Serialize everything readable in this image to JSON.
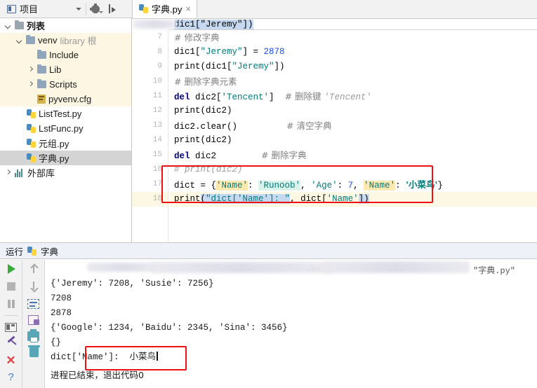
{
  "toolbar": {
    "project_label": "项目",
    "project_icon": "project-icon",
    "settings_icon": "gear-icon",
    "collapse_icon": "collapse-all-icon"
  },
  "editor_tab": {
    "label": "字典.py",
    "close_glyph": "×",
    "file_icon": "python-file-icon"
  },
  "tree": {
    "items": [
      {
        "label": "列表",
        "indent": 0,
        "arrow": "down",
        "icon": "folder-icon",
        "style": "root"
      },
      {
        "label": "venv",
        "indent": 1,
        "arrow": "down",
        "icon": "folder-icon",
        "style": "venv",
        "suffix": "library 根"
      },
      {
        "label": "Include",
        "indent": 2,
        "arrow": "none",
        "icon": "folder-icon",
        "style": "venv"
      },
      {
        "label": "Lib",
        "indent": 2,
        "arrow": "right",
        "icon": "folder-icon",
        "style": "venv"
      },
      {
        "label": "Scripts",
        "indent": 2,
        "arrow": "right",
        "icon": "folder-icon",
        "style": "venv"
      },
      {
        "label": "pyvenv.cfg",
        "indent": 2,
        "arrow": "none",
        "icon": "config-file-icon",
        "style": "venv"
      },
      {
        "label": "ListTest.py",
        "indent": 1,
        "arrow": "none",
        "icon": "python-file-icon",
        "style": "normal"
      },
      {
        "label": "LstFunc.py",
        "indent": 1,
        "arrow": "none",
        "icon": "python-file-icon",
        "style": "normal"
      },
      {
        "label": "元组.py",
        "indent": 1,
        "arrow": "none",
        "icon": "python-file-icon",
        "style": "normal"
      },
      {
        "label": "字典.py",
        "indent": 1,
        "arrow": "none",
        "icon": "python-file-icon",
        "style": "selected"
      },
      {
        "label": "外部库",
        "indent": 0,
        "arrow": "right",
        "icon": "external-libs-icon",
        "style": "normal"
      }
    ]
  },
  "code": {
    "cutoff_line": "dic1[\"Jeremy\"])",
    "line_numbers": [
      "7",
      "8",
      "9",
      "10",
      "11",
      "12",
      "13",
      "14",
      "15",
      "16",
      "17",
      "18"
    ],
    "lines": [
      {
        "no": "7",
        "text": "# 修改字典"
      },
      {
        "no": "8",
        "text": "dic1[\"Jeremy\"] = 2878"
      },
      {
        "no": "9",
        "text": "print(dic1[\"Jeremy\"])"
      },
      {
        "no": "10",
        "text": "# 删除字典元素"
      },
      {
        "no": "11",
        "text": "del dic2['Tencent']  # 删除键 'Tencent'"
      },
      {
        "no": "12",
        "text": "print(dic2)"
      },
      {
        "no": "13",
        "text": "dic2.clear()          # 清空字典"
      },
      {
        "no": "14",
        "text": "print(dic2)"
      },
      {
        "no": "15",
        "text": "del dic2        # 删除字典"
      },
      {
        "no": "16",
        "text": "# print(dic2)"
      },
      {
        "no": "17",
        "text": "dict = {'Name': 'Runoob', 'Age': 7, 'Name': '小菜鸟'}"
      },
      {
        "no": "18",
        "text": "print(\"dict['Name']: \", dict['Name'])"
      }
    ],
    "tokens": {
      "l7_comment": "# 修改字典",
      "l8_var": "dic1[",
      "l8_str": "\"Jeremy\"",
      "l8_assign": "] = ",
      "l8_num": "2878",
      "l9_fn": "print",
      "l9_body": "(dic1[",
      "l9_str": "\"Jeremy\"",
      "l9_tail": "])",
      "l10_comment": "# 删除字典元素",
      "l11_kw": "del",
      "l11_var": " dic2[",
      "l11_str": "'Tencent'",
      "l11_tail": "]  ",
      "l11_comment": "# 删除键 ",
      "l11_comment_i": "'Tencent'",
      "l12_fn": "print",
      "l12_tail": "(dic2)",
      "l13_var": "dic2.clear()",
      "l13_comment": "# 清空字典",
      "l14_fn": "print",
      "l14_tail": "(dic2)",
      "l15_kw": "del",
      "l15_var": " dic2",
      "l15_comment": "# 删除字典",
      "l16_comment": "# print(dic2)",
      "l17_a": "dict = {",
      "l17_key1": "'Name'",
      "l17_b": ": ",
      "l17_val1": "'Runoob'",
      "l17_c": ", ",
      "l17_key2": "'Age'",
      "l17_d": ": ",
      "l17_num": "7",
      "l17_e": ", ",
      "l17_key3": "'Name'",
      "l17_f": ": ",
      "l17_val3": "'小菜鸟'",
      "l17_g": "}",
      "l18_fn": "print",
      "l18_open": "(",
      "l18_str": "\"dict['Name']: \"",
      "l18_mid": ", dict[",
      "l18_str2": "'Name'",
      "l18_close": "])"
    }
  },
  "run_panel": {
    "tab_label": "运行",
    "config_name": "字典",
    "config_icon": "python-file-icon",
    "toolbar_left": [
      {
        "name": "run-button",
        "icon": "play-icon"
      },
      {
        "name": "stop-button",
        "icon": "stop-icon"
      },
      {
        "name": "pause-button",
        "icon": "pause-icon"
      },
      {
        "name": "layout-button",
        "icon": "layout-icon"
      },
      {
        "name": "pin-button",
        "icon": "pin-icon"
      },
      {
        "name": "close-button",
        "icon": "close-icon"
      },
      {
        "name": "help-button",
        "icon": "help-icon"
      }
    ],
    "toolbar_right": [
      {
        "name": "scroll-up-button",
        "icon": "arrow-up-icon"
      },
      {
        "name": "scroll-down-button",
        "icon": "arrow-down-icon"
      },
      {
        "name": "soft-wrap-button",
        "icon": "soft-wrap-icon"
      },
      {
        "name": "export-button",
        "icon": "export-icon"
      },
      {
        "name": "print-button",
        "icon": "print-icon"
      },
      {
        "name": "clear-all-button",
        "icon": "trash-icon"
      }
    ],
    "output": {
      "command_tail": ".exe",
      "command_file": "\"字典.py\"",
      "lines": [
        "{'Jeremy': 7208, 'Susie': 7256}",
        "7208",
        "2878",
        "{'Google': 1234, 'Baidu': 2345, 'Sina': 3456}",
        "{}",
        "dict['Name']:  小菜鸟"
      ],
      "highlighted_line": "dict['Name']:  小菜鸟",
      "exit_message": "进程已结束，退出代码0"
    }
  },
  "annotations": {
    "code_box_color": "#ee1111",
    "output_box_color": "#ee1111"
  }
}
